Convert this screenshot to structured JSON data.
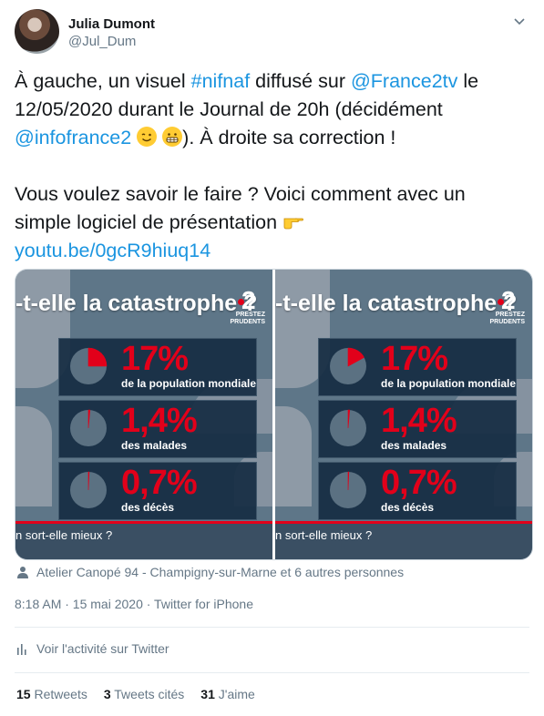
{
  "author": {
    "display_name": "Julia Dumont",
    "handle": "@Jul_Dum"
  },
  "tweet": {
    "line1_pre": "À gauche, un visuel ",
    "hashtag": "#nifnaf",
    "line1_mid": " diffusé sur ",
    "mention1": "@France2tv",
    "line1_post": " le 12/05/2020 durant le Journal de 20h (décidément ",
    "mention2": "@infofrance2",
    "line2_post": "). À droite sa correction !",
    "para2": "Vous voulez savoir le faire ? Voici comment avec un simple logiciel de présentation ",
    "url": "youtu.be/0gcR9hiuq14"
  },
  "media": {
    "title": "-t-elle la catastrophe ?",
    "logo_num": "2",
    "logo_sub_1": "PRESTEZ",
    "logo_sub_2": "PRUDENTS",
    "bottom_text": "n sort-elle mieux ?",
    "stats": [
      {
        "percent": "17%",
        "caption": "de la population mondiale",
        "value": 0.17
      },
      {
        "percent": "1,4%",
        "caption": "des malades",
        "value": 0.014
      },
      {
        "percent": "0,7%",
        "caption": "des décès",
        "value": 0.007
      }
    ],
    "left_fills": [
      0.25,
      0.014,
      0.007
    ],
    "right_fills": [
      0.17,
      0.014,
      0.007
    ]
  },
  "location": "Atelier Canopé 94 - Champigny-sur-Marne et 6 autres personnes",
  "meta": "8:18 AM · 15 mai 2020 · Twitter for iPhone",
  "activity_label": "Voir l'activité sur Twitter",
  "counts": {
    "retweets_num": "15",
    "retweets_label": "Retweets",
    "quotes_num": "3",
    "quotes_label": "Tweets cités",
    "likes_num": "31",
    "likes_label": "J'aime"
  },
  "colors": {
    "link": "#1b95e0",
    "accent_red": "#e2001a",
    "muted": "#657786"
  },
  "icons": [
    "chevron-down-icon",
    "wink-emoji",
    "grimace-emoji",
    "point-right-emoji",
    "person-icon",
    "activity-chart-icon"
  ]
}
